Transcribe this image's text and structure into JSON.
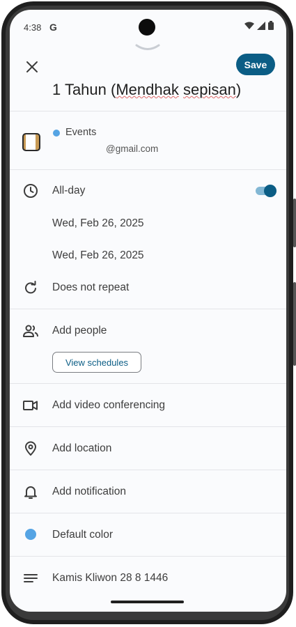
{
  "status_bar": {
    "time": "4:38",
    "g_label": "G"
  },
  "header": {
    "save_label": "Save"
  },
  "event": {
    "title_prefix": "1 Tahun (",
    "title_word1": "Mendhak",
    "title_space": " ",
    "title_word2": "sepisan",
    "title_suffix": ")"
  },
  "account": {
    "calendar_name": "Events",
    "email_suffix": "@gmail.com",
    "calendar_color": "#55a4e4"
  },
  "time": {
    "all_day_label": "All-day",
    "all_day_on": true,
    "start_date": "Wed, Feb 26, 2025",
    "end_date": "Wed, Feb 26, 2025",
    "repeat_label": "Does not repeat"
  },
  "people": {
    "add_label": "Add people",
    "view_schedules_label": "View schedules"
  },
  "video": {
    "label": "Add video conferencing"
  },
  "location": {
    "label": "Add location"
  },
  "notification": {
    "label": "Add notification"
  },
  "color": {
    "label": "Default color",
    "value": "#55a4e4"
  },
  "description": {
    "text": "Kamis Kliwon 28 8 1446"
  },
  "theme": {
    "accent": "#0b5d85",
    "toggle_track": "#82b7d4"
  }
}
